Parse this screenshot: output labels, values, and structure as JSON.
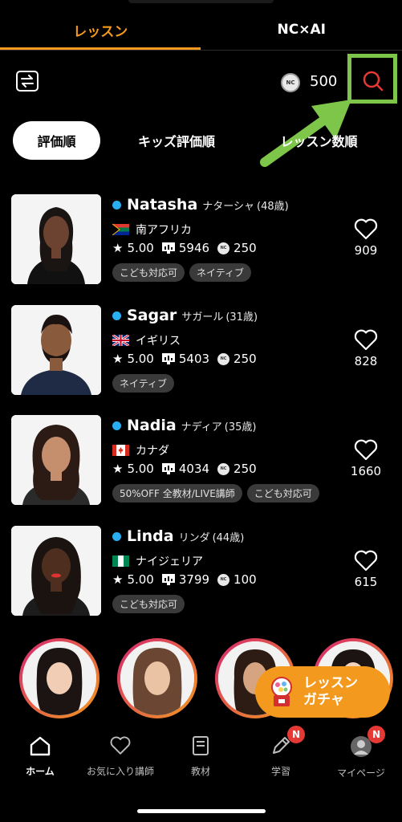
{
  "top_tabs": [
    "レッスン",
    "NC×AI"
  ],
  "coins": "500",
  "coin_icon_text": "NC",
  "sort_tabs": [
    "評価順",
    "キッズ評価順",
    "レッスン数順"
  ],
  "teachers": [
    {
      "name": "Natasha",
      "kana": "ナターシャ",
      "age": "(48歳)",
      "country": "南アフリカ",
      "rating": "5.00",
      "lessons": "5946",
      "price": "250",
      "tags": [
        "こども対応可",
        "ネイティブ"
      ],
      "favorites": "909"
    },
    {
      "name": "Sagar",
      "kana": "サガール",
      "age": "(31歳)",
      "country": "イギリス",
      "rating": "5.00",
      "lessons": "5403",
      "price": "250",
      "tags": [
        "ネイティブ"
      ],
      "favorites": "828"
    },
    {
      "name": "Nadia",
      "kana": "ナディア",
      "age": "(35歳)",
      "country": "カナダ",
      "rating": "5.00",
      "lessons": "4034",
      "price": "250",
      "tags": [
        "50%OFF 全教材/LIVE講師",
        "こども対応可"
      ],
      "favorites": "1660"
    },
    {
      "name": "Linda",
      "kana": "リンダ",
      "age": "(44歳)",
      "country": "ナイジェリア",
      "rating": "5.00",
      "lessons": "3799",
      "price": "100",
      "tags": [
        "こども対応可"
      ],
      "favorites": "615"
    }
  ],
  "gacha": {
    "label": "レッスン\nガチャ"
  },
  "bottom_nav": [
    {
      "label": "ホーム",
      "icon": "home-icon"
    },
    {
      "label": "お気に入り講師",
      "icon": "heart-icon"
    },
    {
      "label": "教材",
      "icon": "book-icon"
    },
    {
      "label": "学習",
      "icon": "pencil-icon",
      "badge": "N"
    },
    {
      "label": "マイページ",
      "icon": "avatar-icon",
      "badge": "N"
    }
  ],
  "colors": {
    "accent": "#f39a1e",
    "highlight": "#7ec64a",
    "search": "#e53935",
    "online": "#29aef2"
  }
}
